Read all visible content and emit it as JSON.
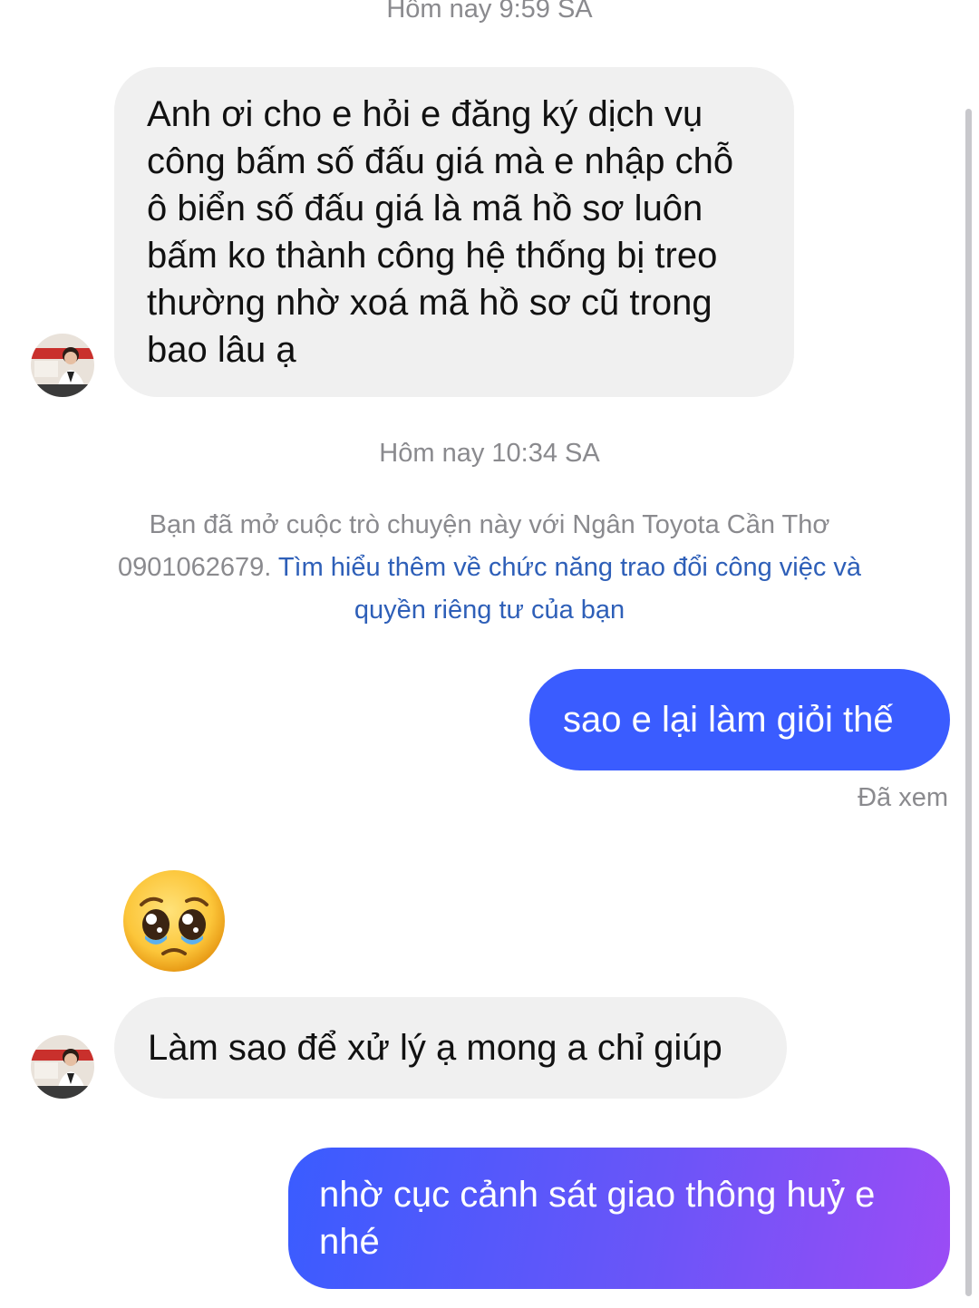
{
  "conversation": {
    "timestamp_1": "Hôm nay 9:59 SA",
    "timestamp_2": "Hôm nay 10:34 SA",
    "notice": {
      "plain": "Bạn đã mở cuộc trò chuyện này với Ngân Toyota Cần Thơ 0901062679. ",
      "link": "Tìm hiểu thêm về chức năng trao đổi công việc và quyền riêng tư của bạn"
    },
    "messages": [
      {
        "from": "contact",
        "text": "Anh ơi cho e hỏi e đăng ký dịch vụ công bấm số đấu giá mà e nhập chỗ ô biển số đấu giá là mã hồ sơ luôn bấm ko thành công hệ thống bị treo thường nhờ xoá mã hồ sơ cũ trong bao lâu ạ"
      },
      {
        "from": "me",
        "text": "sao e lại làm giỏi thế"
      },
      {
        "from": "contact",
        "emoji": "pleading-face"
      },
      {
        "from": "contact",
        "text": "Làm sao để xử lý ạ mong a chỉ giúp"
      },
      {
        "from": "me",
        "text": "nhờ cục cảnh sát giao thông huỷ e nhé"
      }
    ],
    "seen_label": "Đã xem"
  },
  "colors": {
    "incoming_bubble": "#f0f0f0",
    "outgoing_blue": "#3a5cff",
    "outgoing_gradient_end": "#9b4cf5",
    "link": "#2e5fb8",
    "meta_text": "#8a8a8e"
  }
}
